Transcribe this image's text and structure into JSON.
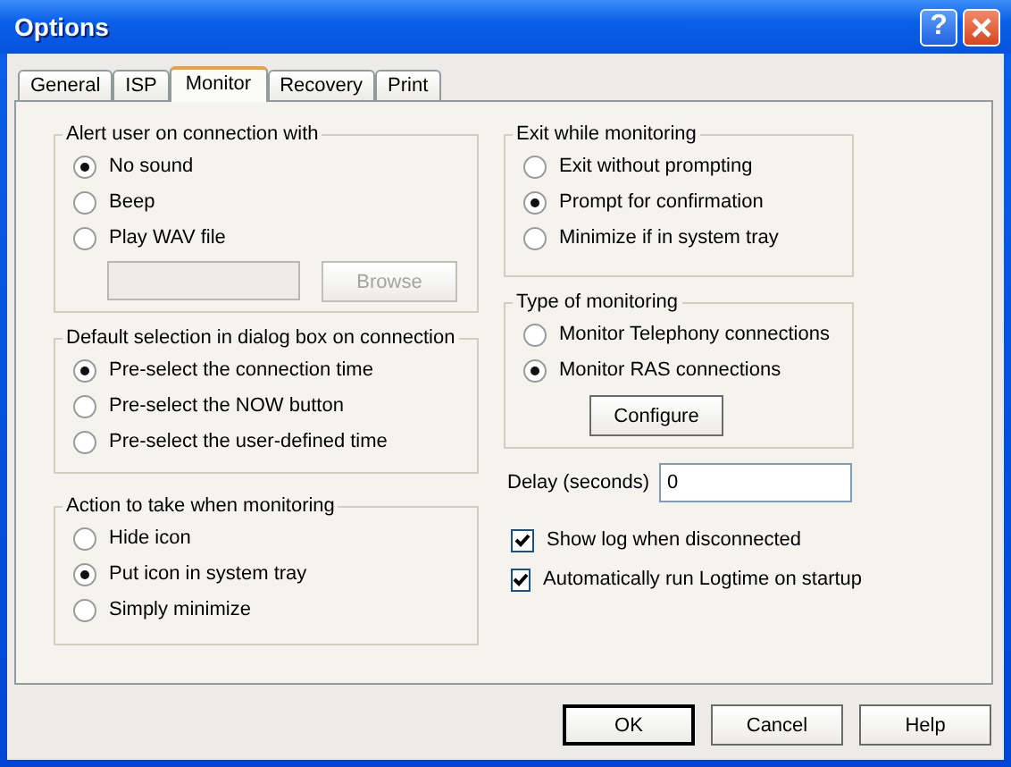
{
  "window": {
    "title": "Options",
    "help_button": "?"
  },
  "tabs": [
    {
      "label": "General",
      "selected": false
    },
    {
      "label": "ISP",
      "selected": false
    },
    {
      "label": "Monitor",
      "selected": true
    },
    {
      "label": "Recovery",
      "selected": false
    },
    {
      "label": "Print",
      "selected": false
    }
  ],
  "left_groups": [
    {
      "title": "Alert user on connection with",
      "options": [
        {
          "label": "No sound",
          "selected": true
        },
        {
          "label": "Beep",
          "selected": false
        },
        {
          "label": "Play WAV file",
          "selected": false
        }
      ],
      "file_field": {
        "disabled": true
      },
      "browse_button": {
        "label": "Browse",
        "disabled": true
      }
    },
    {
      "title": "Default selection in dialog box on connection",
      "options": [
        {
          "label": "Pre-select the connection time",
          "selected": true
        },
        {
          "label": "Pre-select the NOW button",
          "selected": false
        },
        {
          "label": "Pre-select the user-defined time",
          "selected": false
        }
      ]
    },
    {
      "title": "Action to take when monitoring",
      "options": [
        {
          "label": "Hide icon",
          "selected": false
        },
        {
          "label": "Put icon in system tray",
          "selected": true
        },
        {
          "label": "Simply minimize",
          "selected": false
        }
      ]
    }
  ],
  "right_groups": [
    {
      "title": "Exit while monitoring",
      "options": [
        {
          "label": "Exit without prompting",
          "selected": false
        },
        {
          "label": "Prompt for confirmation",
          "selected": true
        },
        {
          "label": "Minimize if in system tray",
          "selected": false
        }
      ]
    },
    {
      "title": "Type of monitoring",
      "options": [
        {
          "label": "Monitor Telephony connections",
          "selected": false
        },
        {
          "label": "Monitor RAS connections",
          "selected": true
        }
      ],
      "button": {
        "label": "Configure",
        "disabled": false
      }
    }
  ],
  "delay": {
    "label": "Delay (seconds)",
    "value": "0"
  },
  "checkboxes": [
    {
      "label": "Show log when disconnected",
      "checked": true
    },
    {
      "label": "Automatically run Logtime on startup",
      "checked": true
    }
  ],
  "buttons": [
    {
      "label": "OK",
      "default": true
    },
    {
      "label": "Cancel",
      "default": false
    },
    {
      "label": "Help",
      "default": false
    }
  ]
}
